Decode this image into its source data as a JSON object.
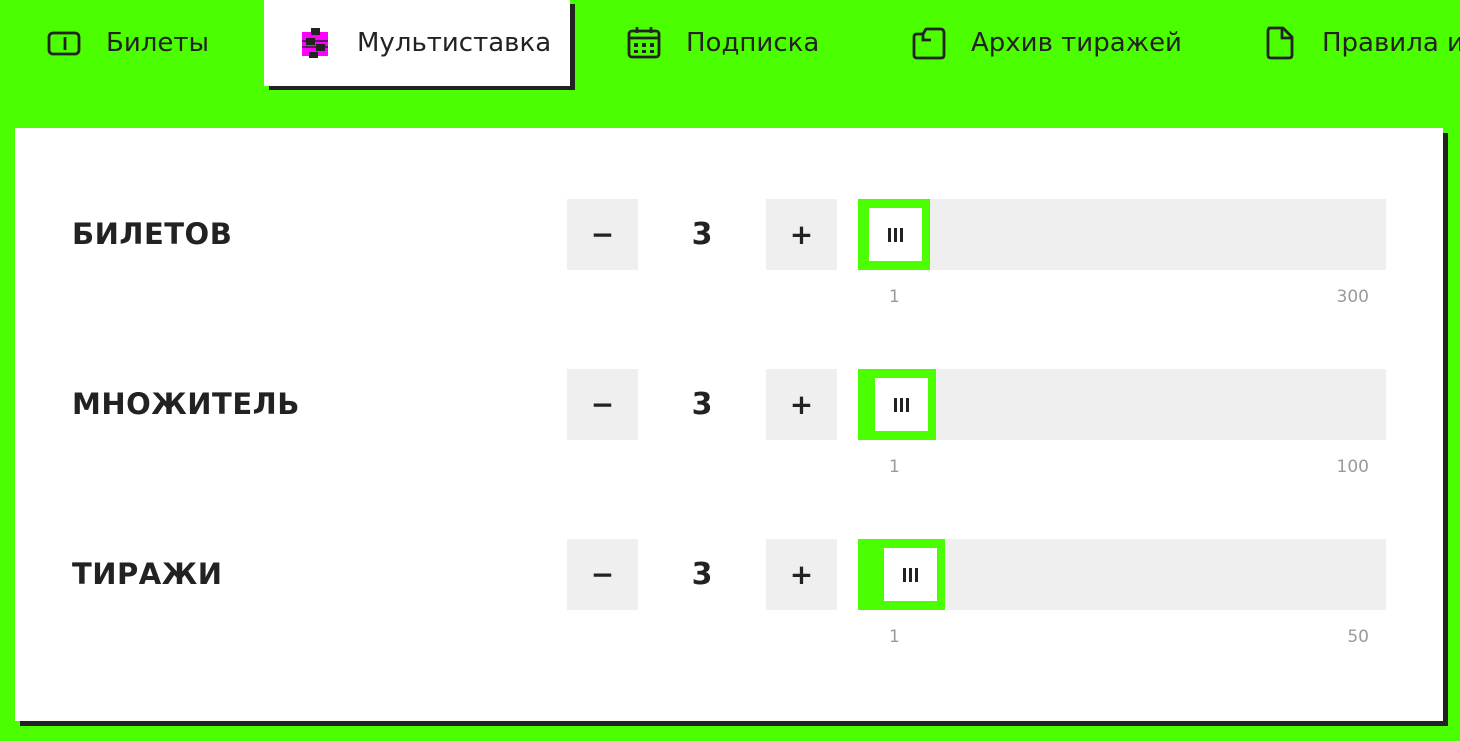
{
  "tabs": [
    {
      "label": "Билеты",
      "icon": "ticket-icon",
      "active": false
    },
    {
      "label": "Мультиставка",
      "icon": "sliders-icon",
      "active": true
    },
    {
      "label": "Подписка",
      "icon": "calendar-icon",
      "active": false
    },
    {
      "label": "Архив тиражей",
      "icon": "archive-icon",
      "active": false
    },
    {
      "label": "Правила и",
      "icon": "document-icon",
      "active": false
    }
  ],
  "controls": [
    {
      "label": "БИЛЕТОВ",
      "value": "3",
      "min": "1",
      "max": "300",
      "minus": "−",
      "plus": "+",
      "slider_fraction": 0.0067
    },
    {
      "label": "МНОЖИТЕЛЬ",
      "value": "3",
      "min": "1",
      "max": "100",
      "minus": "−",
      "plus": "+",
      "slider_fraction": 0.02
    },
    {
      "label": "ТИРАЖИ",
      "value": "3",
      "min": "1",
      "max": "50",
      "minus": "−",
      "plus": "+",
      "slider_fraction": 0.04
    }
  ],
  "colors": {
    "accent": "#4cff00",
    "active_icon": "#ff00ff",
    "track": "#efefef",
    "text": "#222222",
    "muted": "#9a9a9a"
  }
}
